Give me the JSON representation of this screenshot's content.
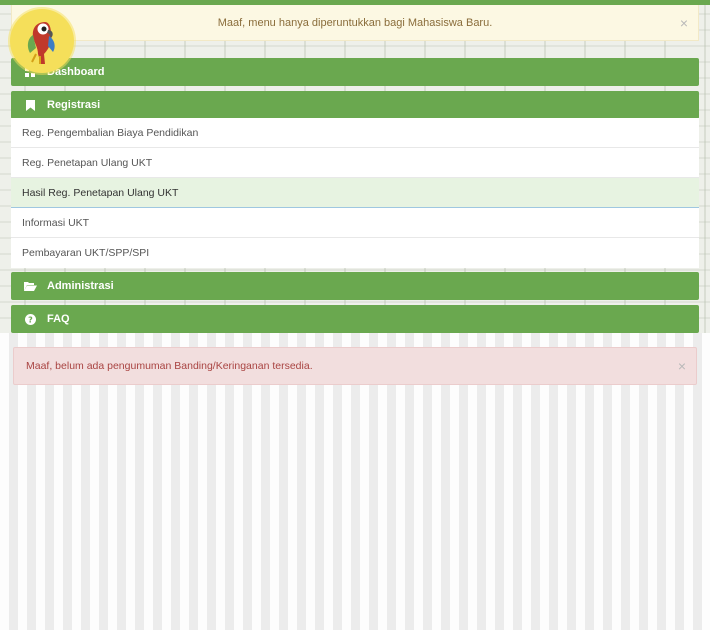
{
  "notice_top": {
    "message": "Maaf, menu hanya diperuntukkan bagi Mahasiswa Baru.",
    "close_glyph": "×"
  },
  "logo": {
    "icon": "parrot-logo-icon"
  },
  "menu": {
    "dashboard": {
      "label": "Dashboard",
      "icon": "grid-icon"
    },
    "registrasi": {
      "label": "Registrasi",
      "icon": "bookmark-icon",
      "items": [
        {
          "label": "Reg. Pengembalian Biaya Pendidikan"
        },
        {
          "label": "Reg. Penetapan Ulang UKT"
        },
        {
          "label": "Hasil Reg. Penetapan Ulang UKT"
        },
        {
          "label": "Informasi UKT"
        },
        {
          "label": "Pembayaran UKT/SPP/SPI"
        }
      ]
    },
    "administrasi": {
      "label": "Administrasi",
      "icon": "folder-open-icon"
    },
    "faq": {
      "label": "FAQ",
      "icon": "question-circle-icon"
    }
  },
  "notice_bottom": {
    "message": "Maaf, belum ada pengumuman Banding/Keringanan tersedia.",
    "close_glyph": "×"
  },
  "colors": {
    "accent_green": "#6aa84f",
    "warning_bg": "#fcf8e3",
    "danger_bg": "#f2dede",
    "active_item_bg": "#e7f3e1"
  }
}
